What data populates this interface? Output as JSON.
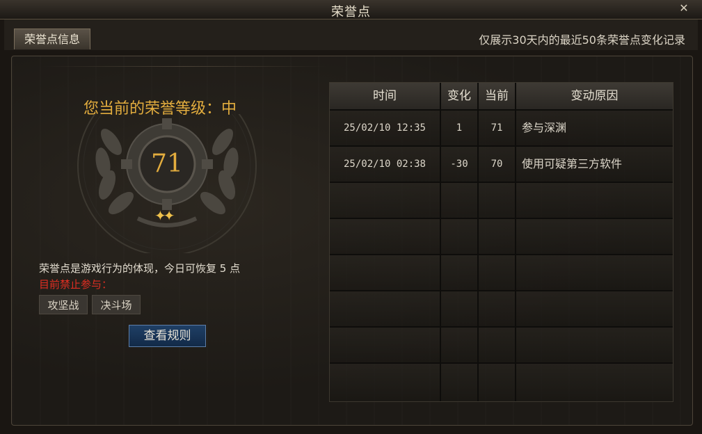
{
  "window": {
    "title": "荣誉点",
    "close_icon": "close-icon"
  },
  "tabs": [
    {
      "label": "荣誉点信息"
    }
  ],
  "notice": "仅展示30天内的最近50条荣誉点变化记录",
  "honor": {
    "level_text": "您当前的荣誉等级：中",
    "points": "71",
    "stars_glyph": "✦✦",
    "description": "荣誉点是游戏行为的体现，今日可恢复 5 点",
    "banned_label": "目前禁止参与：",
    "banned_modes": [
      "攻坚战",
      "决斗场"
    ],
    "rules_button": "查看规则"
  },
  "table": {
    "columns": [
      "时间",
      "变化",
      "当前",
      "变动原因"
    ],
    "rows": [
      {
        "time": "25/02/10 12:35",
        "change": "1",
        "current": "71",
        "reason": "参与深渊"
      },
      {
        "time": "25/02/10 02:38",
        "change": "-30",
        "current": "70",
        "reason": "使用可疑第三方软件"
      },
      {
        "time": "",
        "change": "",
        "current": "",
        "reason": ""
      },
      {
        "time": "",
        "change": "",
        "current": "",
        "reason": ""
      },
      {
        "time": "",
        "change": "",
        "current": "",
        "reason": ""
      },
      {
        "time": "",
        "change": "",
        "current": "",
        "reason": ""
      },
      {
        "time": "",
        "change": "",
        "current": "",
        "reason": ""
      },
      {
        "time": "",
        "change": "",
        "current": "",
        "reason": ""
      }
    ]
  },
  "colors": {
    "gold": "#e3ad3e",
    "red": "#e02e22",
    "button_blue": "#1f3f66"
  }
}
